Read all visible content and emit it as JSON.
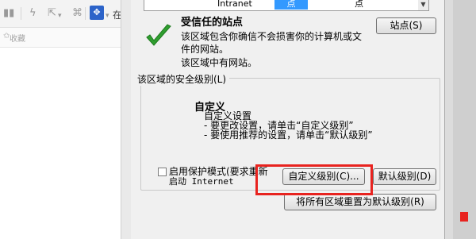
{
  "browser": {
    "toolbar_text": "在",
    "favorites_label": "收藏"
  },
  "dialog": {
    "zones": [
      {
        "label": "Intranet",
        "selected": false
      },
      {
        "label": "点",
        "selected": true
      },
      {
        "label": "点",
        "selected": false
      }
    ],
    "zone_title": "受信任的站点",
    "zone_description_1": "该区域包含你确信不会损害你的计算机或文",
    "zone_description_2": "件的网站。",
    "zone_has_sites": "该区域中有网站。",
    "sites_button": "站点(S)",
    "security_level_group": "该区域的安全级别(L)",
    "level_title": "自定义",
    "level_subtitle": "自定义设置",
    "level_desc_1": "- 要更改设置，请单击“自定义级别”",
    "level_desc_2": "- 要使用推荐的设置，请单击“默认级别”",
    "protected_mode_label": "启用保护模式(要求重新",
    "protected_mode_label_2": "启动 Internet",
    "protected_mode_checked": false,
    "custom_level_button": "自定义级别(C)...",
    "default_level_button": "默认级别(D)",
    "reset_all_button": "将所有区域重置为默认级别(R)"
  },
  "colors": {
    "highlight": "#e8231f",
    "selection": "#3399ff",
    "check_green": "#2f9e2f"
  }
}
